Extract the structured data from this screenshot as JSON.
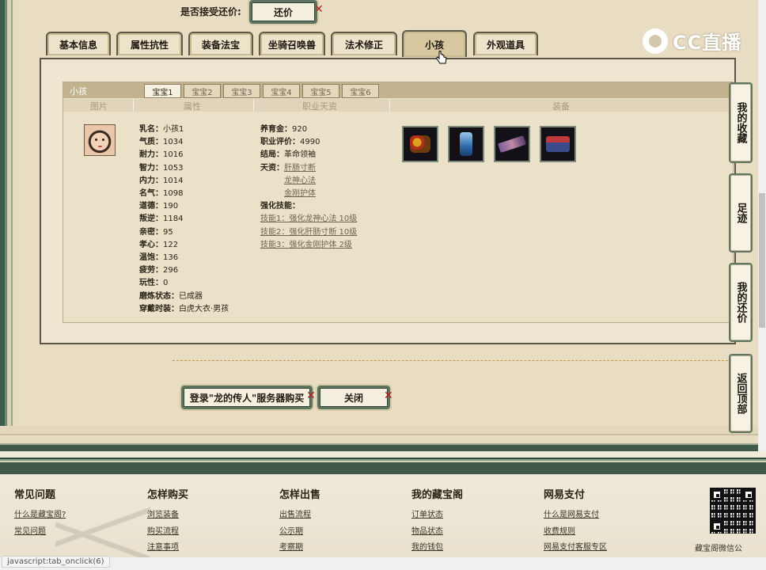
{
  "top": {
    "accept_label": "是否接受还价:",
    "counter_offer_button": "还价"
  },
  "logo": {
    "text": "CC直播"
  },
  "tabs": [
    {
      "label": "基本信息",
      "active": false
    },
    {
      "label": "属性抗性",
      "active": false
    },
    {
      "label": "装备法宝",
      "active": false
    },
    {
      "label": "坐骑召唤兽",
      "active": false
    },
    {
      "label": "法术修正",
      "active": false
    },
    {
      "label": "小孩",
      "active": true
    },
    {
      "label": "外观道具",
      "active": false
    }
  ],
  "child_panel": {
    "title": "小孩",
    "subtabs": [
      "宝宝1",
      "宝宝2",
      "宝宝3",
      "宝宝4",
      "宝宝5",
      "宝宝6"
    ],
    "columns": {
      "picture": "图片",
      "attributes": "属性",
      "career": "职业天资",
      "equipment": "装备"
    },
    "attributes": [
      {
        "label": "乳名：",
        "value": "小孩1"
      },
      {
        "label": "气质：",
        "value": "1034"
      },
      {
        "label": "耐力：",
        "value": "1016"
      },
      {
        "label": "智力：",
        "value": "1053"
      },
      {
        "label": "内力：",
        "value": "1014"
      },
      {
        "label": "名气：",
        "value": "1098"
      },
      {
        "label": "道德：",
        "value": "190"
      },
      {
        "label": "叛逆：",
        "value": "1184"
      },
      {
        "label": "亲密：",
        "value": "95"
      },
      {
        "label": "孝心：",
        "value": "122"
      },
      {
        "label": "温饱：",
        "value": "136"
      },
      {
        "label": "疲劳：",
        "value": "296"
      },
      {
        "label": "玩性：",
        "value": "0"
      },
      {
        "label": "磨炼状态：",
        "value": "已成器"
      },
      {
        "label": "穿戴时装：",
        "value": "白虎大衣·男孩"
      }
    ],
    "career": {
      "nurture_label": "养育金：",
      "nurture_value": "920",
      "rating_label": "职业评价：",
      "rating_value": "4990",
      "ending_label": "结局：",
      "ending_value": "革命领袖",
      "talent_label": "天资：",
      "talents": [
        "肝肠寸断",
        "龙神心法",
        "金刚护体"
      ],
      "skills_label": "强化技能：",
      "skills": [
        "技能1：强化龙神心法 10级",
        "技能2：强化肝肠寸断 10级",
        "技能3：强化金刚护体 2级"
      ]
    },
    "equipment_icons": [
      "fruit-basket-icon",
      "blue-armor-icon",
      "jade-sword-box-icon",
      "treasure-chest-icon"
    ]
  },
  "actions": {
    "buy_button": "登录\"龙的传人\"服务器购买",
    "close_button": "关闭"
  },
  "side_nav": [
    {
      "label": "我的收藏"
    },
    {
      "label": "足迹"
    },
    {
      "label": "我的还价"
    },
    {
      "label": "返回顶部"
    }
  ],
  "footer": {
    "columns": [
      {
        "title": "常见问题",
        "links": [
          "什么是藏宝阁?",
          "常见问题"
        ]
      },
      {
        "title": "怎样购买",
        "links": [
          "浏览装备",
          "购买流程",
          "注意事项"
        ]
      },
      {
        "title": "怎样出售",
        "links": [
          "出售流程",
          "公示期",
          "考察期"
        ]
      },
      {
        "title": "我的藏宝阁",
        "links": [
          "订单状态",
          "物品状态",
          "我的钱包"
        ]
      },
      {
        "title": "网易支付",
        "links": [
          "什么是网易支付",
          "收费规则",
          "网易支付客服专区"
        ]
      }
    ],
    "qr_caption": "藏宝阁微信公"
  },
  "status_bar": {
    "text": "javascript:tab_onclick(6)"
  }
}
